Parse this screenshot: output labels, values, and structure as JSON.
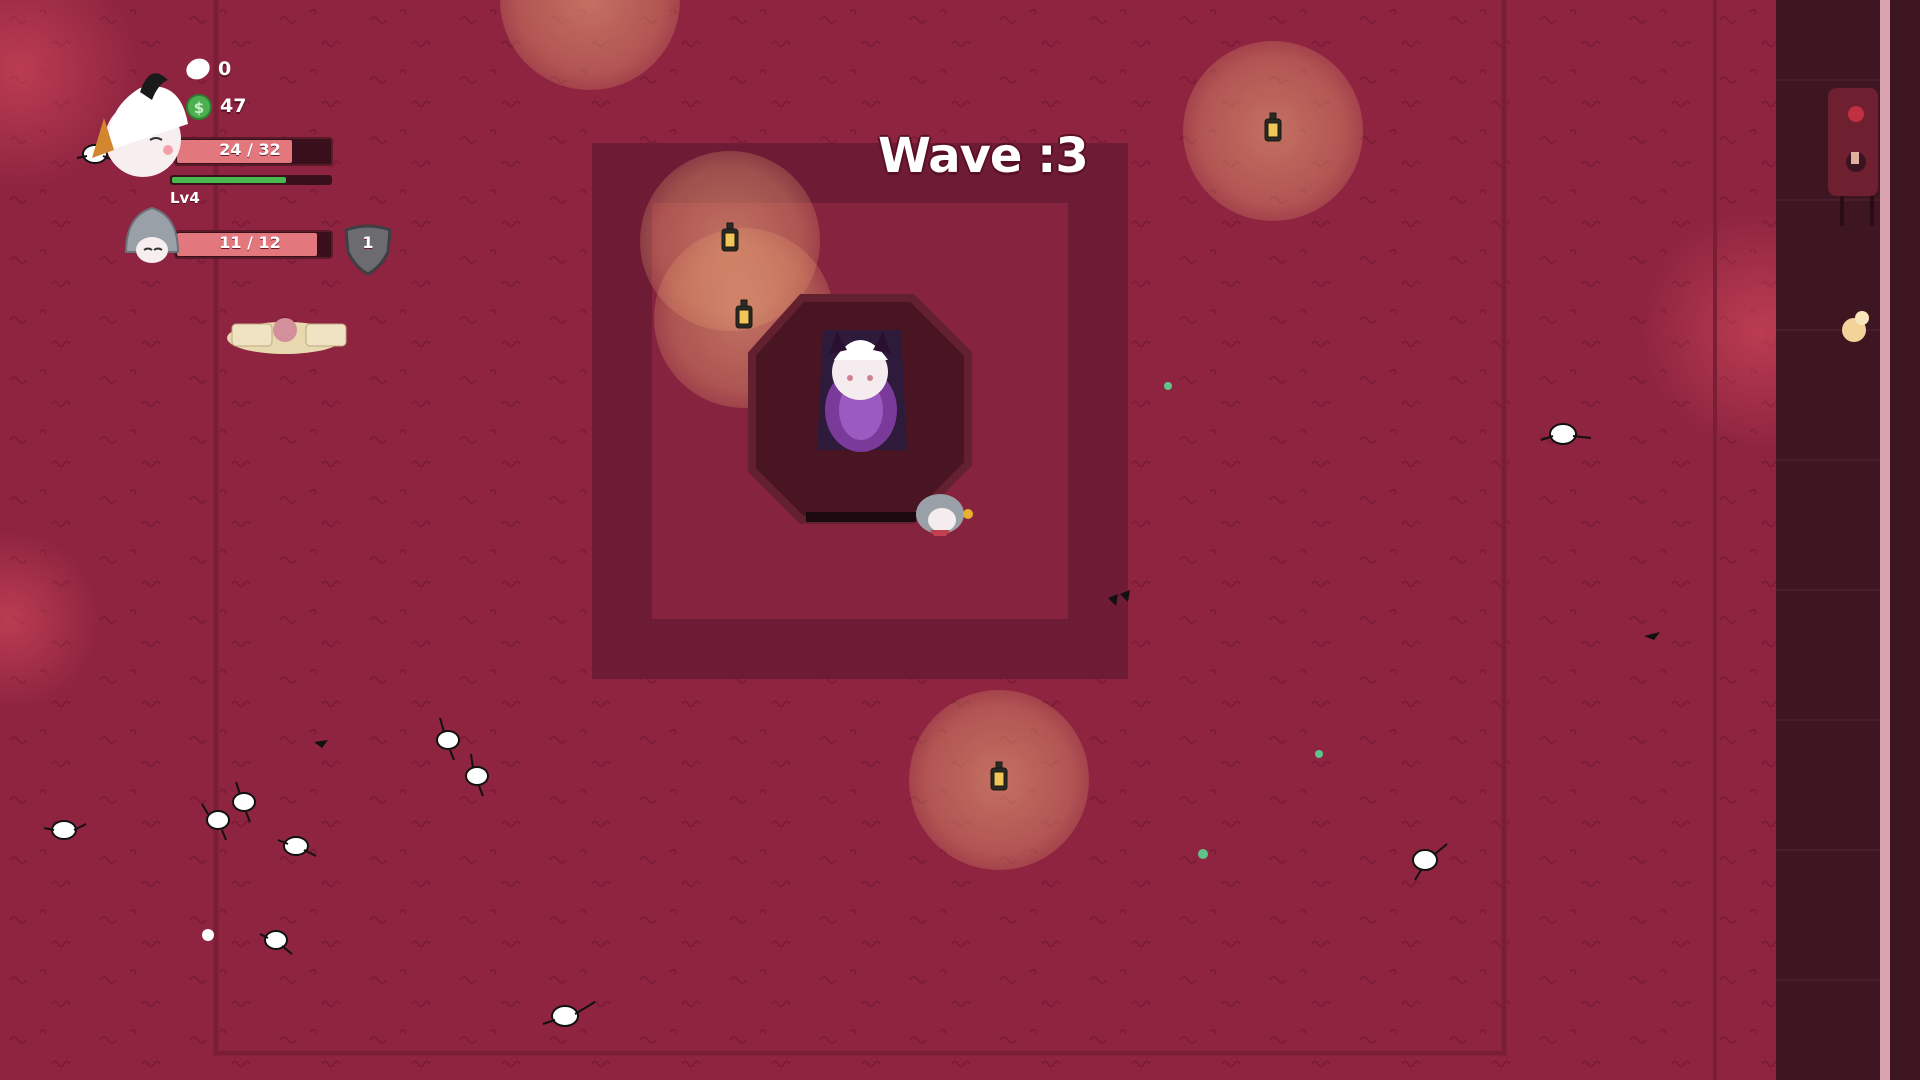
{
  "hud": {
    "wave_label": "Wave :3",
    "souls": "0",
    "coins": "47",
    "player": {
      "hp_text": "24 / 32",
      "hp_fraction": 0.75,
      "xp_fraction": 0.72,
      "level_label": "Lv4",
      "portrait_icon": "horned-girl-portrait-icon"
    },
    "ally": {
      "hp_text": "11 / 12",
      "hp_fraction": 0.917,
      "shield_value": "1",
      "portrait_icon": "hooded-knight-portrait-icon"
    },
    "icons": [
      "soul-icon",
      "coin-icon",
      "shield-icon"
    ]
  },
  "colors": {
    "floor": "#8e2440",
    "inner_floor": "#80203b",
    "altar_ring": "#5e1a30",
    "altar": "#4a1523",
    "hp_fill": "#e2777d",
    "hp_empty": "#3a0f1c",
    "xp_fill": "#49b84f",
    "wall": "#3d1622",
    "light": "#e8a070"
  },
  "scene": {
    "lanterns": 5,
    "enemies": 14,
    "entity_icons": [
      "lantern-icon",
      "skeleton-spider-icon",
      "priestess-boss-icon",
      "knight-ally-icon",
      "treasure-pile-icon",
      "cake-icon",
      "xp-orb-icon",
      "crow-feather-icon"
    ]
  }
}
